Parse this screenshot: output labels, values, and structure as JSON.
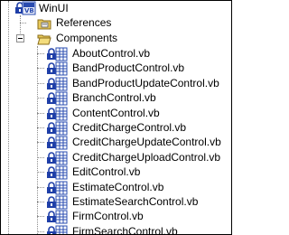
{
  "project": {
    "label": "WinUI",
    "badge": "VB"
  },
  "references": {
    "label": "References"
  },
  "components": {
    "label": "Components",
    "files": [
      "AboutControl.vb",
      "BandProductControl.vb",
      "BandProductUpdateControl.vb",
      "BranchControl.vb",
      "ContentControl.vb",
      "CreditChargeControl.vb",
      "CreditChargeUpdateControl.vb",
      "CreditChargeUploadControl.vb",
      "EditControl.vb",
      "EstimateControl.vb",
      "EstimateSearchControl.vb",
      "FirmControl.vb",
      "FirmSearchControl.vb"
    ]
  },
  "colors": {
    "lock": "#1f3fa8",
    "folder": "#e8c95a",
    "file_frame": "#2a4cb0"
  }
}
